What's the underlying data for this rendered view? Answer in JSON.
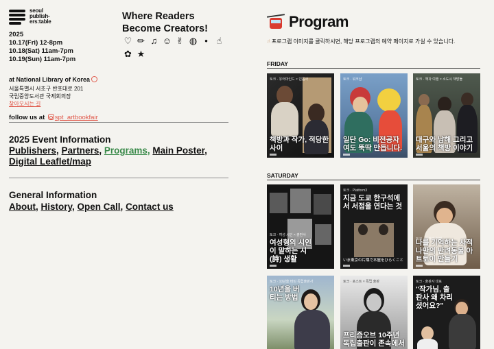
{
  "logo": {
    "text": "seoul\npublish-\ners:table"
  },
  "festival": {
    "year": "2025",
    "dates": [
      "10.17(Fri) 12-8pm",
      "10.18(Sat) 11am-7pm",
      "10.19(Sun) 11am-7pm"
    ]
  },
  "tagline": "Where Readers Become Creators!",
  "icons": [
    "♡",
    "✏",
    "♫",
    "☺",
    "✌",
    "◍",
    "•",
    "☝",
    "✿",
    "★"
  ],
  "venue": {
    "title": "at National Library of Korea",
    "address": "서울특별시 서초구 반포대로 201",
    "building": "국립중앙도서관 국제회의장",
    "map_link": "찾아오시는 길"
  },
  "follow": {
    "label": "follow us at",
    "handle": "spt_artbookfair"
  },
  "event_info": {
    "title": "2025 Event Information",
    "links": [
      {
        "label": "Publishers",
        "sep": ", "
      },
      {
        "label": "Partners",
        "sep": ", "
      },
      {
        "label": "Programs,",
        "sep": " "
      },
      {
        "label": "Main Poster",
        "sep": ","
      },
      {
        "label": "Digital Leaflet/map",
        "sep": ""
      }
    ]
  },
  "general_info": {
    "title": "General Information",
    "links": [
      {
        "label": "About",
        "sep": ", "
      },
      {
        "label": "History",
        "sep": ", "
      },
      {
        "label": "Open Call",
        "sep": ", "
      },
      {
        "label": "Contact us",
        "sep": ""
      }
    ]
  },
  "program": {
    "title": "Program",
    "notice": "프로그램 이미지를 클릭하시면, 해당 프로그램의 예약 페이지로 가실 수 있습니다.",
    "days": [
      {
        "label": "FRIDAY",
        "cards": [
          {
            "tag": "토크 · 유어마인드 × 민음사",
            "title": "책방과 작가, 적당한 사이"
          },
          {
            "tag": "토크 · 워크샵",
            "title": "일단 Go: 비전공자여도 뚝딱 만듭니다."
          },
          {
            "tag": "토크 · 책과 여행 × 소도시 책방들",
            "title": "대구와 남해 그리고 서울의 책방 이야기"
          }
        ]
      },
      {
        "label": "SATURDAY",
        "cards": [
          {
            "tag": "토크 · 여성 시인 × 출판사",
            "title": "여성형의 시인이 말하는 시(詩) 생활"
          },
          {
            "tag": "토크 · Platform3",
            "title": "지금 도쿄 한구석에서 서점을 연다는 것",
            "sub": "いま東京の片隅で本屋をひらくこと"
          },
          {
            "tag": "토크 · 작가와 함께",
            "title": "나를 기억하는 사적 나만의 반려동물 아트토이 만들기"
          },
          {
            "tag": "토크 · 10년을 버틴 독립출판사",
            "title": "10년을 버티는 방법"
          },
          {
            "tag": "토크 · 포스트 × 독립 출판",
            "title": "프리즘오브 10주년 독립출판이 존속에서"
          },
          {
            "tag": "토크 · 출판사 대표",
            "title": "\"작가님, 출판사 왜 차리셨어요?\""
          }
        ]
      }
    ]
  }
}
